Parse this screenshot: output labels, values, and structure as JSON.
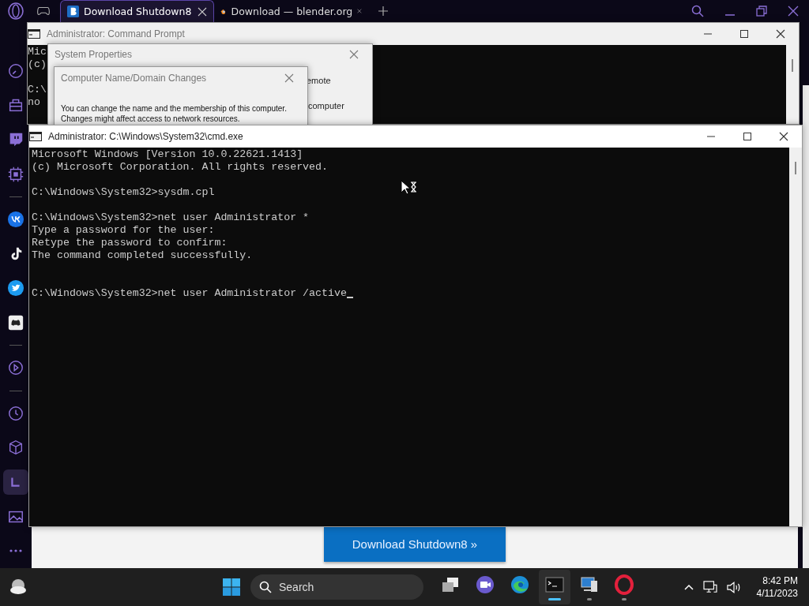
{
  "browser": {
    "tabs": [
      {
        "title": "Download Shutdown8",
        "selected": true,
        "kind": "letter-b"
      },
      {
        "title": "Download — blender.org",
        "selected": false,
        "kind": "blender"
      }
    ],
    "sidebar": [
      {
        "kind": "speedometer",
        "selected": false
      },
      {
        "kind": "bag",
        "selected": false
      },
      {
        "kind": "twitch",
        "selected": false
      },
      {
        "kind": "chip",
        "selected": false
      },
      {
        "kind": "divider"
      },
      {
        "kind": "vk",
        "selected": false
      },
      {
        "kind": "tiktok",
        "selected": false
      },
      {
        "kind": "twitter",
        "selected": false
      },
      {
        "kind": "discord",
        "selected": false
      },
      {
        "kind": "divider"
      },
      {
        "kind": "play",
        "selected": false
      },
      {
        "kind": "divider"
      },
      {
        "kind": "clock",
        "selected": false
      },
      {
        "kind": "cube",
        "selected": false
      },
      {
        "kind": "chart",
        "selected": true
      },
      {
        "kind": "picture",
        "selected": false
      },
      {
        "kind": "more",
        "selected": false
      }
    ],
    "page": {
      "button": "Download Shutdown8 »"
    }
  },
  "back_console": {
    "title": "Administrator:  Command Prompt",
    "lines": [
      {
        "kind": "text",
        "text": "Mic"
      },
      {
        "kind": "text",
        "text": "(c)"
      },
      {
        "kind": "blank"
      },
      {
        "kind": "text",
        "text": "C:\\"
      },
      {
        "kind": "text",
        "text": "no"
      }
    ]
  },
  "system_properties": {
    "title": "System Properties",
    "tab_fragment": "emote",
    "text_fragment": "computer"
  },
  "name_dialog": {
    "title": "Computer Name/Domain Changes",
    "message": "You can change the name and the membership of this computer. Changes might affect access to network resources."
  },
  "console": {
    "title": "Administrator: C:\\Windows\\System32\\cmd.exe",
    "cursor": true,
    "lines": [
      {
        "kind": "text",
        "text": "Microsoft Windows [Version 10.0.22621.1413]"
      },
      {
        "kind": "text",
        "text": "(c) Microsoft Corporation. All rights reserved."
      },
      {
        "kind": "blank"
      },
      {
        "kind": "text",
        "text": "C:\\Windows\\System32>sysdm.cpl"
      },
      {
        "kind": "blank"
      },
      {
        "kind": "text",
        "text": "C:\\Windows\\System32>net user Administrator *"
      },
      {
        "kind": "text",
        "text": "Type a password for the user:"
      },
      {
        "kind": "text",
        "text": "Retype the password to confirm:"
      },
      {
        "kind": "text",
        "text": "The command completed successfully."
      },
      {
        "kind": "blank"
      },
      {
        "kind": "blank"
      },
      {
        "kind": "text",
        "text": "C:\\Windows\\System32>net user Administrator /active"
      }
    ]
  },
  "taskbar": {
    "search": {
      "placeholder": "Search"
    },
    "apps": [
      {
        "kind": "task-view",
        "selected": false,
        "running": false
      },
      {
        "kind": "video-chat",
        "selected": false,
        "running": false
      },
      {
        "kind": "edge",
        "selected": false,
        "running": false
      },
      {
        "kind": "terminal",
        "selected": true,
        "running": true
      },
      {
        "kind": "computer",
        "selected": false,
        "running": true
      },
      {
        "kind": "opera",
        "selected": false,
        "running": true
      }
    ],
    "clock": {
      "time": "8:42 PM",
      "date": "4/11/2023"
    }
  }
}
